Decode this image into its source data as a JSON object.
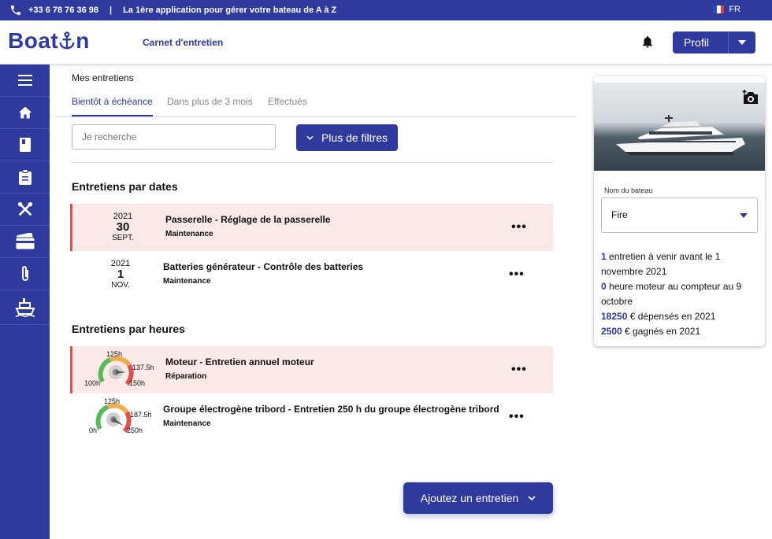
{
  "topbar": {
    "phone": "+33 6 78 76 36 98",
    "tagline": "La 1ère application pour gérer votre bateau de A à Z",
    "lang": "FR"
  },
  "header": {
    "logo": "Boat",
    "logo_end": "n",
    "nav_active": "Carnet d'entretien",
    "profile_label": "Profil"
  },
  "main": {
    "title": "Mes entretiens",
    "tabs": [
      {
        "label": "Bientôt à échéance"
      },
      {
        "label": "Dans plus de 3 mois"
      },
      {
        "label": "Effectués"
      }
    ],
    "search_placeholder": "Je recherche",
    "filters_label": "Plus de filtres",
    "section_dates": "Entretiens par dates",
    "section_hours": "Entretiens par heures",
    "date_rows": [
      {
        "year": "2021",
        "day": "30",
        "month": "SEPT.",
        "title": "Passerelle",
        "detail": "Réglage de la passerelle",
        "category": "Maintenance",
        "more": "•••"
      },
      {
        "year": "2021",
        "day": "1",
        "month": "NOV.",
        "title": "Batteries générateur",
        "detail": "Contrôle des batteries",
        "category": "Maintenance",
        "more": "•••"
      }
    ],
    "hour_rows": [
      {
        "g_top": "125h",
        "g_right": "137.5h",
        "g_left": "100h",
        "g_bottom": "150h",
        "title": "Moteur",
        "detail": "Entretien annuel moteur",
        "category": "Réparation",
        "more": "•••"
      },
      {
        "g_top": "125h",
        "g_right": "187.5h",
        "g_left": "0h",
        "g_bottom": "250h",
        "title": "Groupe électrogène tribord",
        "detail": "Entretien 250 h du groupe électrogène tribord",
        "category": "Maintenance",
        "more": "•••"
      }
    ],
    "add_label": "Ajoutez un entretien"
  },
  "boat_card": {
    "field_label": "Nom du bateau",
    "boat_name": "Fire",
    "stat1_num": "1",
    "stat1_text": " entretien à venir avant le 1 novembre 2021",
    "stat2_num": "0",
    "stat2_text": " heure moteur au compteur au 9 octobre",
    "stat3_num": "18250",
    "stat3_text": " € dépensés en 2021",
    "stat4_num": "2500",
    "stat4_text": " € gagnés en 2021"
  },
  "colors": {
    "brand": "#2e3a9c",
    "alert_bg": "#fbe9e8",
    "alert_border": "#d9534f"
  }
}
